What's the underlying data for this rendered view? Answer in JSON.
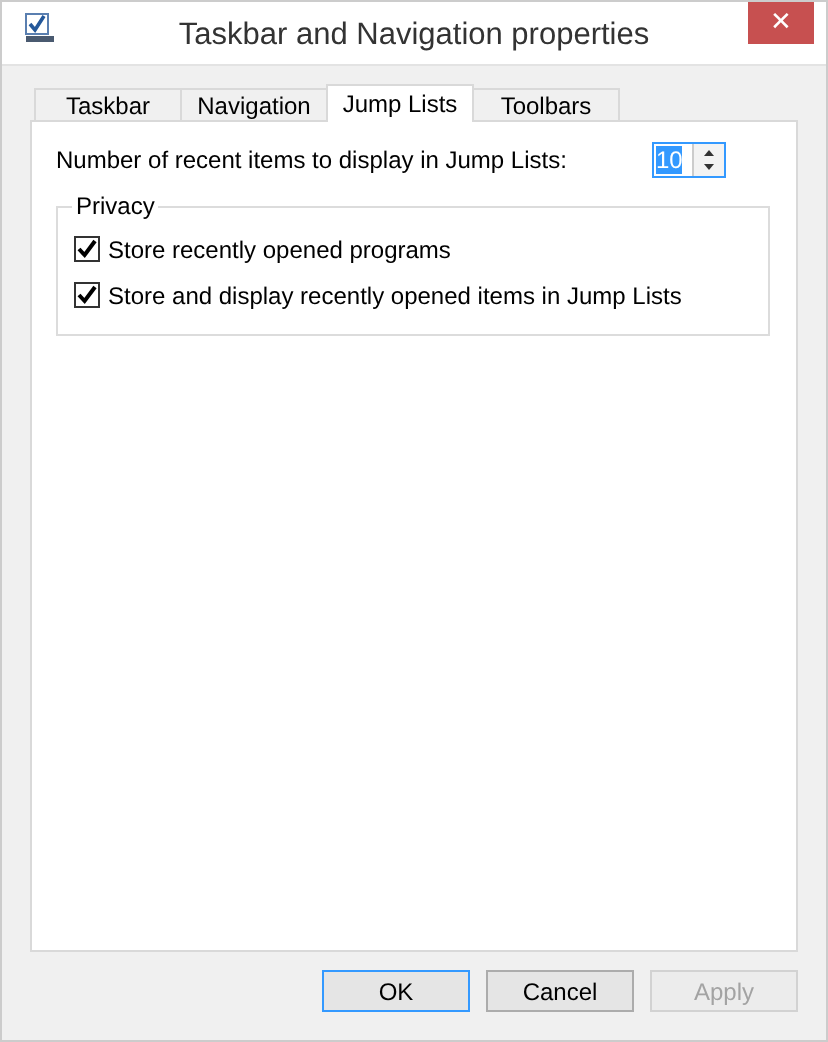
{
  "window": {
    "title": "Taskbar and Navigation properties",
    "close": "✕"
  },
  "tabs": [
    {
      "label": "Taskbar",
      "selected": false
    },
    {
      "label": "Navigation",
      "selected": false
    },
    {
      "label": "Jump Lists",
      "selected": true
    },
    {
      "label": "Toolbars",
      "selected": false
    }
  ],
  "recent_items": {
    "label": "Number of recent items to display in Jump Lists:",
    "value": "10"
  },
  "privacy": {
    "title": "Privacy",
    "options": [
      {
        "label": "Store recently opened programs",
        "checked": true
      },
      {
        "label": "Store and display recently opened items in Jump Lists",
        "checked": true
      }
    ]
  },
  "buttons": [
    {
      "label": "OK",
      "default": true,
      "disabled": false
    },
    {
      "label": "Cancel",
      "default": false,
      "disabled": false
    },
    {
      "label": "Apply",
      "default": false,
      "disabled": true
    }
  ]
}
